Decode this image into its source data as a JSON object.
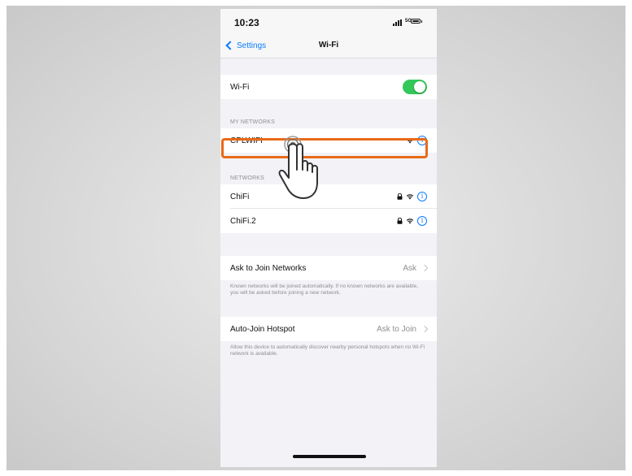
{
  "status_bar": {
    "time": "10:23",
    "network_type": "5G"
  },
  "nav": {
    "back_label": "Settings",
    "title": "Wi-Fi"
  },
  "wifi": {
    "label": "Wi-Fi",
    "enabled": true
  },
  "my_networks": {
    "header": "MY NETWORKS",
    "items": [
      {
        "name": "CPLWIFI",
        "locked": false
      }
    ]
  },
  "networks": {
    "header": "NETWORKS",
    "items": [
      {
        "name": "ChiFi",
        "locked": true
      },
      {
        "name": "ChiFi.2",
        "locked": true
      }
    ]
  },
  "ask_to_join": {
    "label": "Ask to Join Networks",
    "value": "Ask",
    "description": "Known networks will be joined automatically. If no known networks are available, you will be asked before joining a new network."
  },
  "auto_join_hotspot": {
    "label": "Auto-Join Hotspot",
    "value": "Ask to Join",
    "description": "Allow this device to automatically discover nearby personal hotspots when no Wi-Fi network is available."
  },
  "colors": {
    "accent": "#0a7aff",
    "toggle_on": "#34c759",
    "highlight": "#e86a17"
  }
}
